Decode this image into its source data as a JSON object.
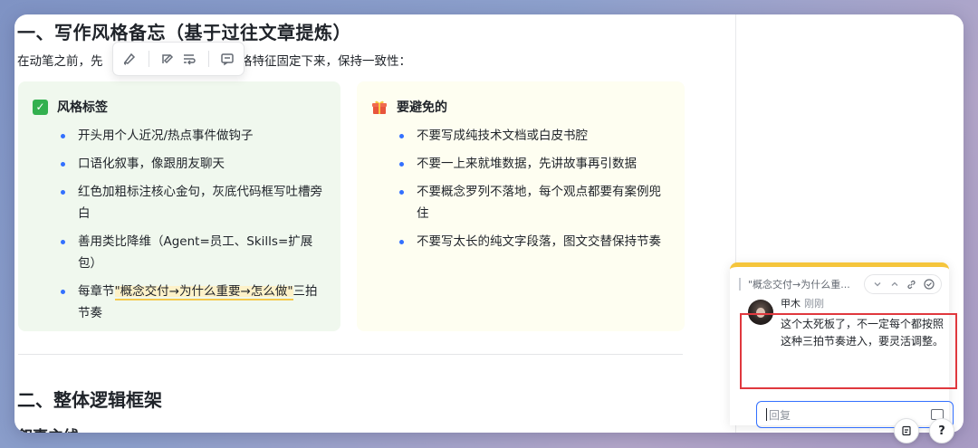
{
  "doc": {
    "heading1": "一、写作风格备忘（基于过往文章提炼）",
    "intro_before": "在动笔之前，先",
    "intro_after": "风格特征固定下来，保持一致性：",
    "callout_style": {
      "emoji": "✅",
      "title": "风格标签",
      "items": [
        "开头用个人近况/热点事件做钩子",
        "口语化叙事，像跟朋友聊天",
        "红色加粗标注核心金句，灰底代码框写吐槽旁白",
        "善用类比降维（Agent=员工、Skills=扩展包）"
      ],
      "last_item_before": "每章节",
      "last_item_highlight": "\"概念交付→为什么重要→怎么做\"",
      "last_item_after": "三拍节奏"
    },
    "callout_avoid": {
      "emoji": "🎁",
      "title": "要避免的",
      "items": [
        "不要写成纯技术文档或白皮书腔",
        "不要一上来就堆数据，先讲故事再引数据",
        "不要概念罗列不落地，每个观点都要有案例兜住",
        "不要写太长的纯文字段落，图文交替保持节奏"
      ]
    },
    "heading2": "二、整体逻辑框架",
    "heading3": "叙事主线"
  },
  "toolbar": {
    "icons": [
      "format-painter-icon",
      "comment-style-icon",
      "text-wrap-icon",
      "add-comment-icon"
    ]
  },
  "comment": {
    "quote": "\"概念交付→为什么重...",
    "author": "甲木",
    "time": "刚刚",
    "text": "这个太死板了，不一定每个都按照这种三拍节奏进入，要灵活调整。",
    "reply_placeholder": "回复"
  },
  "colors": {
    "accent": "#3370ff",
    "highlight_border": "#f5c94a",
    "comment_top": "#f5c53c",
    "annotation_box": "#e0383e"
  }
}
